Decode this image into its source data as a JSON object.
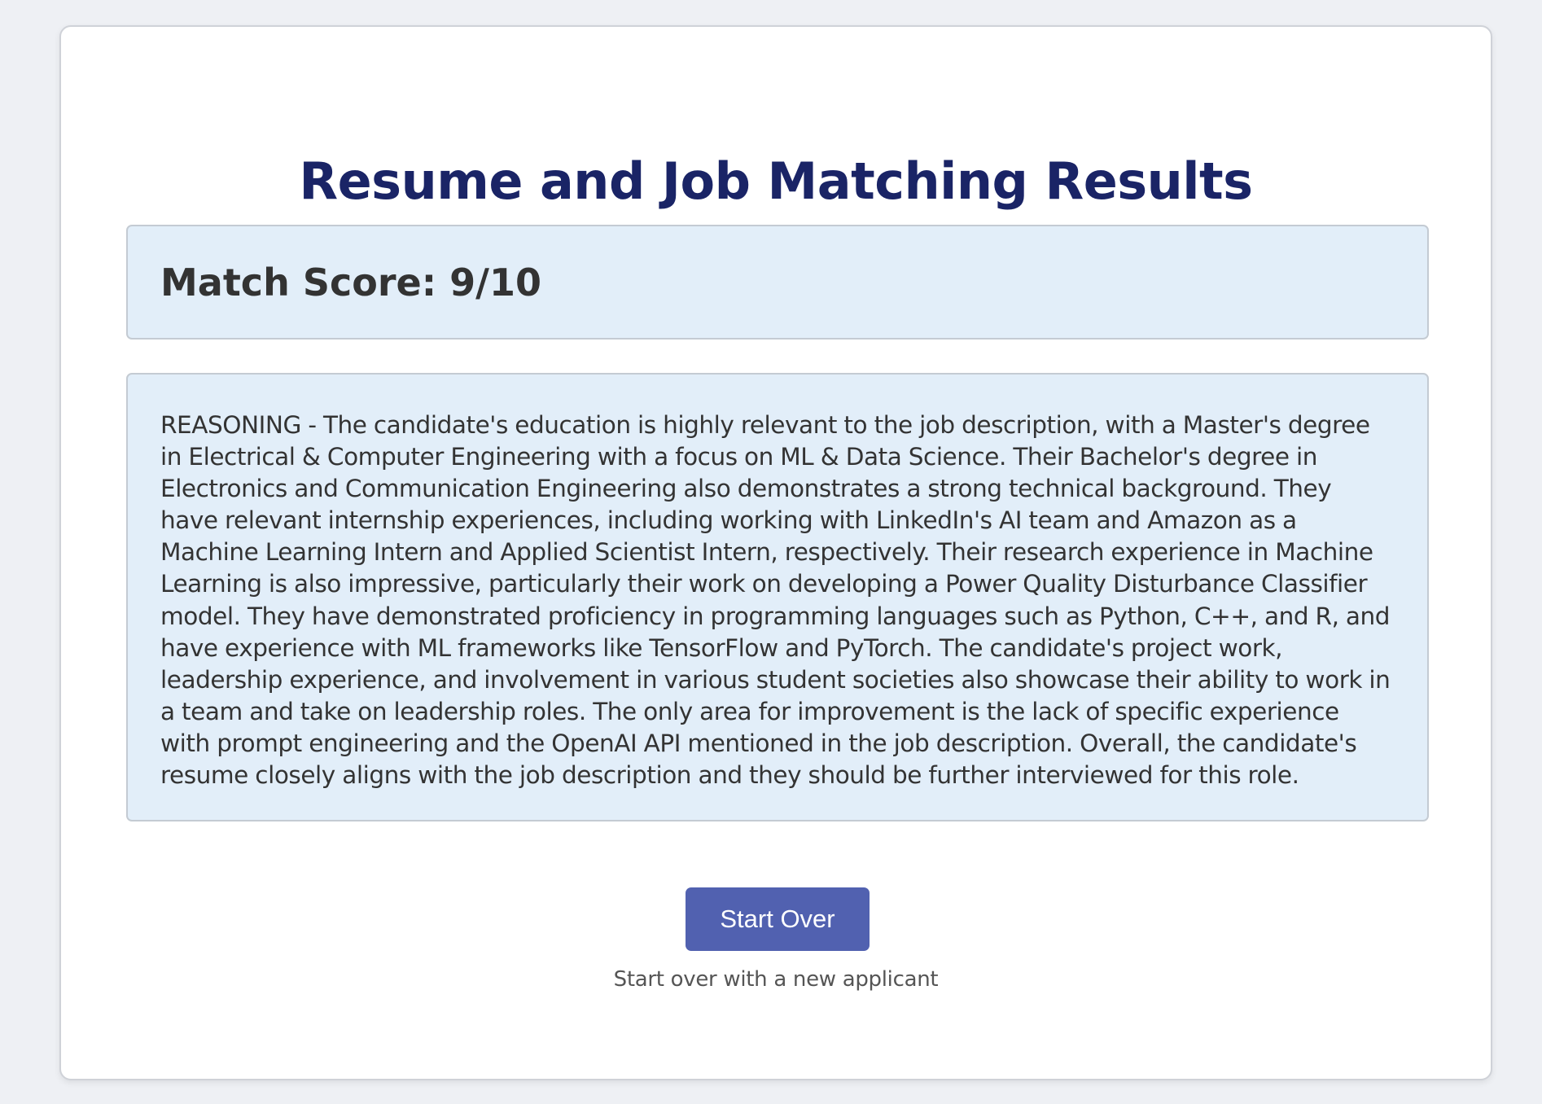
{
  "page": {
    "title": "Resume and Job Matching Results"
  },
  "score": {
    "label": "Match Score: 9/10",
    "value": 9,
    "max": 10
  },
  "reasoning": {
    "text": "REASONING - The candidate's education is highly relevant to the job description, with a Master's degree in Electrical & Computer Engineering with a focus on ML & Data Science. Their Bachelor's degree in Electronics and Communication Engineering also demonstrates a strong technical background. They have relevant internship experiences, including working with LinkedIn's AI team and Amazon as a Machine Learning Intern and Applied Scientist Intern, respectively. Their research experience in Machine Learning is also impressive, particularly their work on developing a Power Quality Disturbance Classifier model. They have demonstrated proficiency in programming languages such as Python, C++, and R, and have experience with ML frameworks like TensorFlow and PyTorch. The candidate's project work, leadership experience, and involvement in various student societies also showcase their ability to work in a team and take on leadership roles. The only area for improvement is the lack of specific experience with prompt engineering and the OpenAI API mentioned in the job description. Overall, the candidate's resume closely aligns with the job description and they should be further interviewed for this role."
  },
  "actions": {
    "start_over_label": "Start Over",
    "start_over_hint": "Start over with a new applicant"
  },
  "colors": {
    "background": "#eef0f4",
    "title": "#1a2466",
    "panel": "#e2eef9",
    "button": "#5161b0"
  }
}
